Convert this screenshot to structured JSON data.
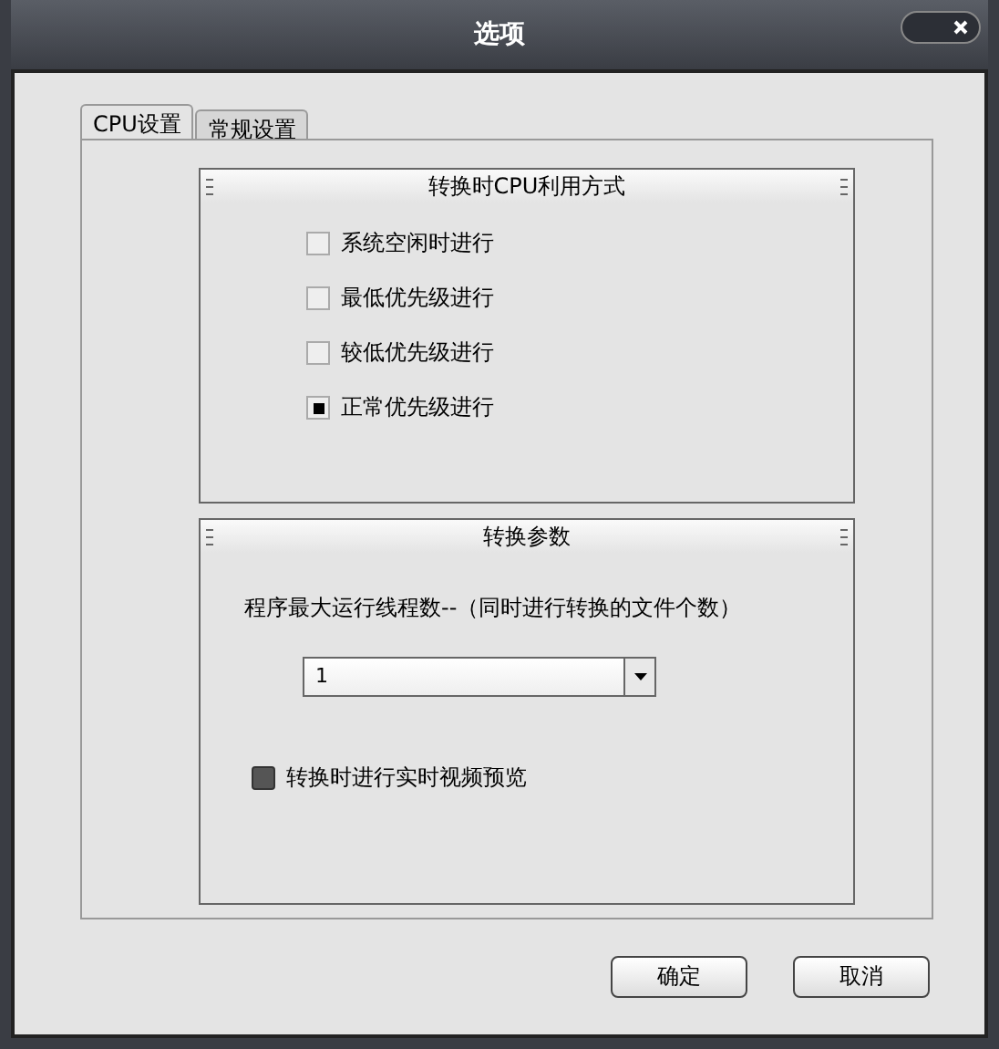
{
  "window": {
    "title": "选项"
  },
  "tabs": [
    {
      "label": "CPU设置",
      "selected": true
    },
    {
      "label": "常规设置",
      "selected": false
    }
  ],
  "cpu_group": {
    "title": "转换时CPU利用方式",
    "options": [
      {
        "label": "系统空闲时进行",
        "checked": false
      },
      {
        "label": "最低优先级进行",
        "checked": false
      },
      {
        "label": "较低优先级进行",
        "checked": false
      },
      {
        "label": "正常优先级进行",
        "checked": true
      }
    ]
  },
  "params_group": {
    "title": "转换参数",
    "thread_label": "程序最大运行线程数--（同时进行转换的文件个数）",
    "thread_value": "1",
    "preview": {
      "label": "转换时进行实时视频预览",
      "checked": true
    }
  },
  "buttons": [
    "确定",
    "取消"
  ]
}
